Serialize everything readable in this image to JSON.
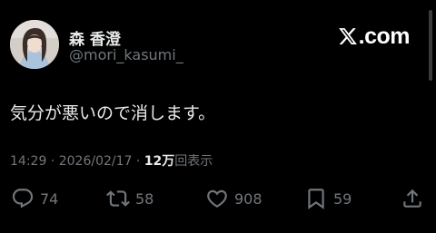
{
  "author": {
    "display_name": "森 香澄",
    "handle": "@mori_kasumi_"
  },
  "brand": {
    "icon": "x-logo-icon",
    "text": ".com"
  },
  "tweet": {
    "text": "気分が悪いので消します。"
  },
  "meta": {
    "time": "14:29",
    "separator": "·",
    "date": "2026/02/17",
    "views_count": "12万",
    "views_label": "回表示"
  },
  "actions": {
    "reply": {
      "icon": "reply-icon",
      "count": "74"
    },
    "retweet": {
      "icon": "retweet-icon",
      "count": "58"
    },
    "like": {
      "icon": "heart-icon",
      "count": "908"
    },
    "bookmark": {
      "icon": "bookmark-icon",
      "count": "59"
    },
    "share": {
      "icon": "share-icon"
    }
  },
  "colors": {
    "background": "#000000",
    "primary_text": "#e7e9ea",
    "secondary_text": "#71767b"
  }
}
